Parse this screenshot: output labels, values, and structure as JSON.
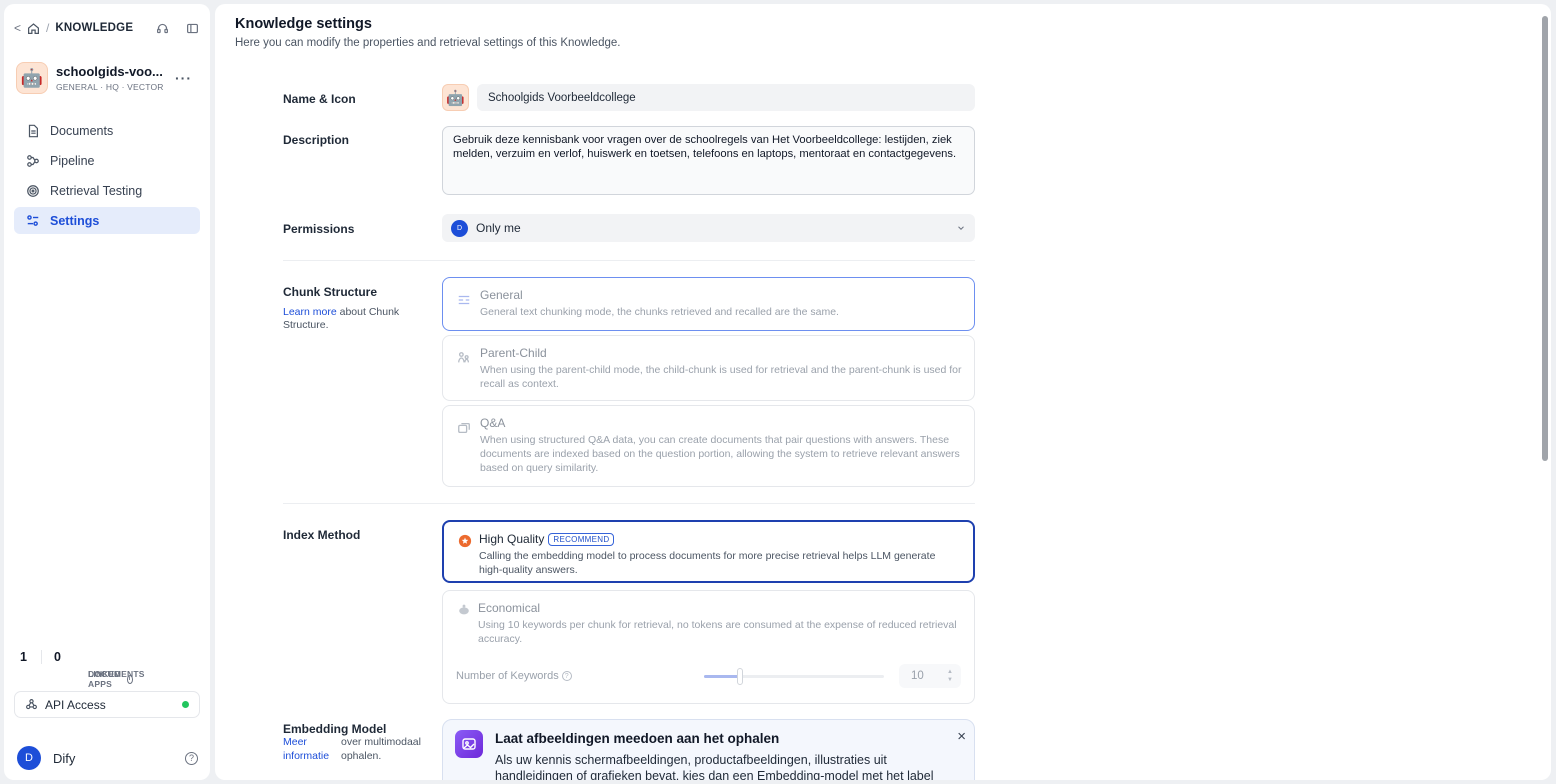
{
  "sidebar": {
    "breadcrumb": {
      "back": "<",
      "separator": "/",
      "title": "KNOWLEDGE"
    },
    "kb": {
      "name": "schoolgids-voo...",
      "meta": "GENERAL · HQ · VECTOR",
      "more": "···",
      "avatar": "🤖"
    },
    "nav": [
      {
        "label": "Documents",
        "icon": "document-icon"
      },
      {
        "label": "Pipeline",
        "icon": "pipeline-icon"
      },
      {
        "label": "Retrieval Testing",
        "icon": "target-icon"
      },
      {
        "label": "Settings",
        "icon": "settings-sliders-icon",
        "active": true
      }
    ],
    "stats": [
      {
        "num": "1",
        "label": "DOCUMENTS"
      },
      {
        "num": "0",
        "label": "LINKED APPS"
      }
    ],
    "api_label": "API Access",
    "user": {
      "initial": "D",
      "name": "Dify",
      "help": "?"
    }
  },
  "main": {
    "title": "Knowledge settings",
    "subtitle": "Here you can modify the properties and retrieval settings of this Knowledge.",
    "name_icon_label": "Name & Icon",
    "name_value": "Schoolgids Voorbeeldcollege",
    "description_label": "Description",
    "description_value": "Gebruik deze kennisbank voor vragen over de schoolregels van Het Voorbeeldcollege: lestijden, ziek melden, verzuim en verlof, huiswerk en toetsen, telefoons en laptops, mentoraat en contactgegevens.",
    "permissions_label": "Permissions",
    "permissions_value": "Only me",
    "permissions_avatar": "D",
    "chunk_label": "Chunk Structure",
    "chunk_link": "Learn more",
    "chunk_link_rest": " about Chunk Structure.",
    "chunk_options": [
      {
        "title": "General",
        "desc": "General text chunking mode, the chunks retrieved and recalled are the same."
      },
      {
        "title": "Parent-Child",
        "desc": "When using the parent-child mode, the child-chunk is used for retrieval and the parent-chunk is used for recall as context."
      },
      {
        "title": "Q&A",
        "desc": "When using structured Q&A data, you can create documents that pair questions with answers. These documents are indexed based on the question portion, allowing the system to retrieve relevant answers based on query similarity."
      }
    ],
    "index_label": "Index Method",
    "index_options": [
      {
        "title": "High Quality",
        "badge": "RECOMMEND",
        "desc": "Calling the embedding model to process documents for more precise retrieval helps LLM generate high-quality answers."
      },
      {
        "title": "Economical",
        "desc": "Using 10 keywords per chunk for retrieval, no tokens are consumed at the expense of reduced retrieval accuracy."
      }
    ],
    "keywords_label": "Number of Keywords",
    "keywords_value": "10",
    "keywords_fraction": 0.2,
    "embedding_label": "Embedding Model",
    "embedding_link_1": "Meer",
    "embedding_link_2": "informatie",
    "embedding_rest_1": "over multimodaal",
    "embedding_rest_2": "ophalen.",
    "banner": {
      "title": "Laat afbeeldingen meedoen aan het ophalen",
      "desc": "Als uw kennis schermafbeeldingen, productafbeeldingen, illustraties uit handleidingen of grafieken bevat, kies dan een Embedding-model met het label",
      "close": "×"
    }
  }
}
